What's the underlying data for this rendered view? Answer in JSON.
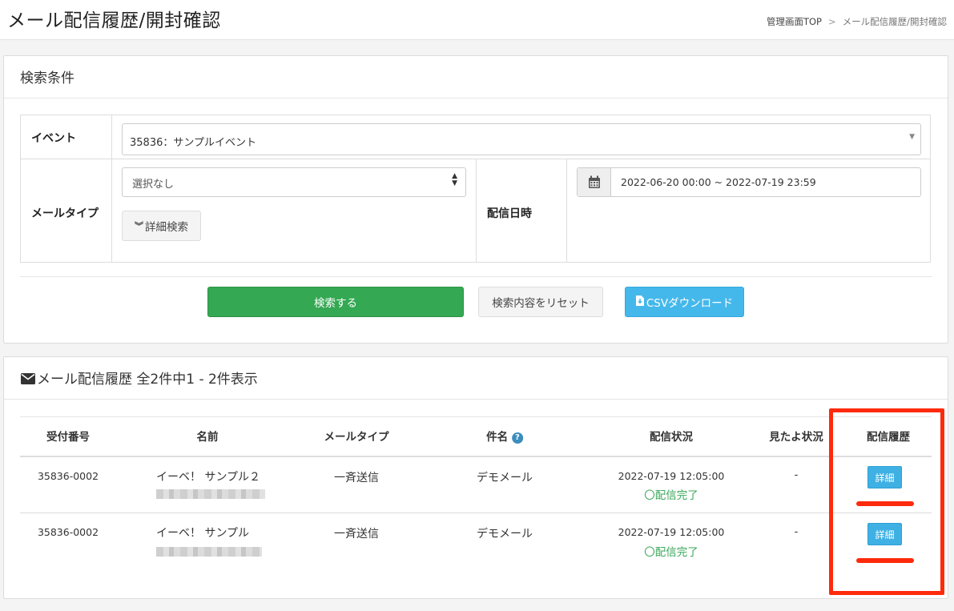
{
  "header": {
    "title": "メール配信履歴/開封確認",
    "breadcrumb": [
      {
        "label": "管理画面TOP"
      },
      {
        "label": "メール配信履歴/開封確認"
      }
    ],
    "breadcrumb_sep": ">"
  },
  "search": {
    "title": "検索条件",
    "event_label": "イベント",
    "event_value": "35836：サンプルイベント",
    "mail_type_label": "メールタイプ",
    "mail_type_value": "選択なし",
    "detail_search_label": "詳細検索",
    "delivery_date_label": "配信日時",
    "delivery_date_value": "2022-06-20 00:00 ~ 2022-07-19 23:59",
    "submit_label": "検索する",
    "reset_label": "検索内容をリセット",
    "csv_label": "CSVダウンロード"
  },
  "history": {
    "title": "メール配信履歴 全2件中1 - 2件表示",
    "columns": [
      "受付番号",
      "名前",
      "メールタイプ",
      "件名",
      "配信状況",
      "見たよ状況",
      "配信履歴"
    ],
    "rows": [
      {
        "id": "35836-0002",
        "name": "イーベ！ サンプル２",
        "mail_type": "一斉送信",
        "subject": "デモメール",
        "date": "2022-07-19 12:05:00",
        "status": "配信完了",
        "seen": "-",
        "action": "詳細"
      },
      {
        "id": "35836-0002",
        "name": "イーベ！ サンプル",
        "mail_type": "一斉送信",
        "subject": "デモメール",
        "date": "2022-07-19 12:05:00",
        "status": "配信完了",
        "seen": "-",
        "action": "詳細"
      }
    ]
  },
  "colors": {
    "primary_green": "#34a853",
    "csv_blue": "#45b8eb",
    "detail_blue": "#3fb0e3",
    "status_green": "#3aa65a",
    "annotation_red": "#ff2a0c"
  }
}
